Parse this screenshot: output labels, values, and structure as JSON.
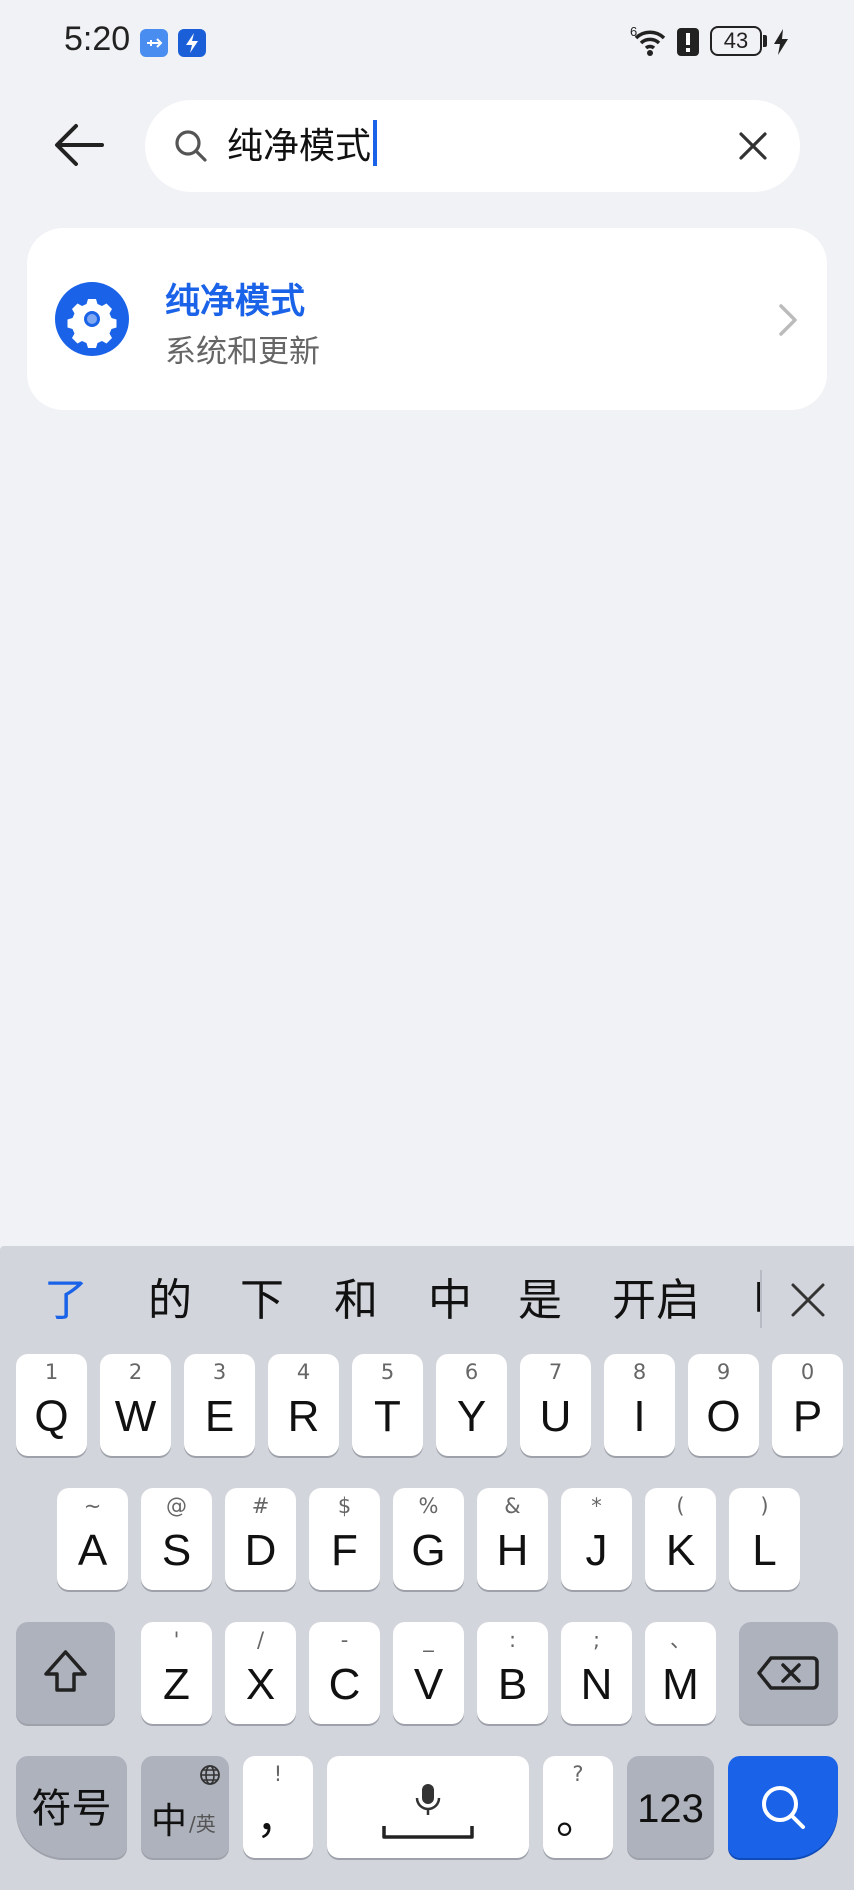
{
  "status_bar": {
    "time": "5:20",
    "battery": "43",
    "network_sup": "6"
  },
  "search": {
    "query": "纯净模式",
    "back_icon": "arrow-left-icon",
    "search_icon": "magnifier-icon",
    "clear_icon": "close-icon"
  },
  "result": {
    "title": "纯净模式",
    "subtitle": "系统和更新",
    "icon": "gear-icon",
    "accent": "#1a63e8"
  },
  "keyboard": {
    "candidates": [
      "了",
      "的",
      "下",
      "和",
      "中",
      "是",
      "开启",
      "叫"
    ],
    "row1": [
      {
        "sub": "1",
        "main": "Q"
      },
      {
        "sub": "2",
        "main": "W"
      },
      {
        "sub": "3",
        "main": "E"
      },
      {
        "sub": "4",
        "main": "R"
      },
      {
        "sub": "5",
        "main": "T"
      },
      {
        "sub": "6",
        "main": "Y"
      },
      {
        "sub": "7",
        "main": "U"
      },
      {
        "sub": "8",
        "main": "I"
      },
      {
        "sub": "9",
        "main": "O"
      },
      {
        "sub": "0",
        "main": "P"
      }
    ],
    "row2": [
      {
        "sub": "~",
        "main": "A"
      },
      {
        "sub": "@",
        "main": "S"
      },
      {
        "sub": "#",
        "main": "D"
      },
      {
        "sub": "$",
        "main": "F"
      },
      {
        "sub": "%",
        "main": "G"
      },
      {
        "sub": "&",
        "main": "H"
      },
      {
        "sub": "*",
        "main": "J"
      },
      {
        "sub": "(",
        "main": "K"
      },
      {
        "sub": ")",
        "main": "L"
      }
    ],
    "row3": [
      {
        "sub": "'",
        "main": "Z"
      },
      {
        "sub": "/",
        "main": "X"
      },
      {
        "sub": "-",
        "main": "C"
      },
      {
        "sub": "_",
        "main": "V"
      },
      {
        "sub": ":",
        "main": "B"
      },
      {
        "sub": ";",
        "main": "N"
      },
      {
        "sub": "、",
        "main": "M"
      }
    ],
    "symbols_label": "符号",
    "lang_main": "中",
    "lang_sub": "/英",
    "comma_sub": "!",
    "comma_main": "，",
    "period_sub": "?",
    "period_main": "。",
    "num_label": "123"
  }
}
